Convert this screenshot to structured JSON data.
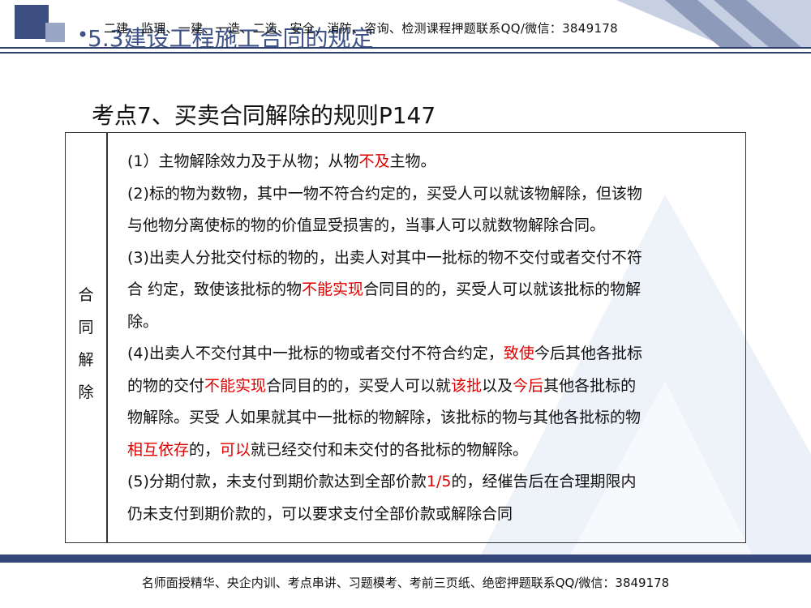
{
  "header": {
    "bullet": "•",
    "section_title": "5.3建设工程施工合同的规定",
    "watermark": "二建、监理、一建、一造、二造、安全、消防、咨询、检测课程押题联系QQ/微信：3849178"
  },
  "title": "考点7、买卖合同解除的规则P147",
  "table": {
    "side_label": [
      "合",
      "同",
      "解",
      "除"
    ],
    "lines": [
      [
        {
          "t": "(1）主物解除效力及于从物；从物"
        },
        {
          "t": "不及",
          "r": 1
        },
        {
          "t": "主物。"
        }
      ],
      [
        {
          "t": "(2)标的物为数物，其中一物不符合约定的，买受人可以就该物解除，但该物"
        }
      ],
      [
        {
          "t": "与他物分离使标的物的价值显受损害的，当事人可以就数物解除合同。"
        }
      ],
      [
        {
          "t": "(3)出卖人分批交付标的物的，出卖人对其中一批标的物不交付或者交付不符"
        }
      ],
      [
        {
          "t": "合 约定，致使该批标的物"
        },
        {
          "t": "不能实现",
          "r": 1
        },
        {
          "t": "合同目的的，买受人可以就该批标的物解"
        }
      ],
      [
        {
          "t": "除。"
        }
      ],
      [
        {
          "t": "(4)出卖人不交付其中一批标的物或者交付不符合约定，"
        },
        {
          "t": "致使",
          "r": 1
        },
        {
          "t": "今后其他各批标"
        }
      ],
      [
        {
          "t": "的物的交付"
        },
        {
          "t": "不能实现",
          "r": 1
        },
        {
          "t": "合同目的的，买受人可以就"
        },
        {
          "t": "该批",
          "r": 1
        },
        {
          "t": "以及"
        },
        {
          "t": "今后",
          "r": 1
        },
        {
          "t": "其他各批标的"
        }
      ],
      [
        {
          "t": "物解除。买受 人如果就其中一批标的物解除，该批标的物与其他各批标的物"
        }
      ],
      [
        {
          "t": "相互依存",
          "r": 1
        },
        {
          "t": "的，"
        },
        {
          "t": "可以",
          "r": 1
        },
        {
          "t": "就已经交付和未交付的各批标的物解除。"
        }
      ],
      [
        {
          "t": "(5)分期付款，未支付到期价款达到全部价款"
        },
        {
          "t": "1/5",
          "r": 1
        },
        {
          "t": "的，经催告后在合理期限内"
        }
      ],
      [
        {
          "t": "仍未支付到期价款的，可以要求支付全部价款或解除合同"
        }
      ]
    ]
  },
  "footer": "名师面授精华、央企内训、考点串讲、习题模考、考前三页纸、绝密押题联系QQ/微信：3849178",
  "colors": {
    "accent": "#34467a",
    "highlight": "#e00000",
    "title_blue": "#3e5288"
  }
}
